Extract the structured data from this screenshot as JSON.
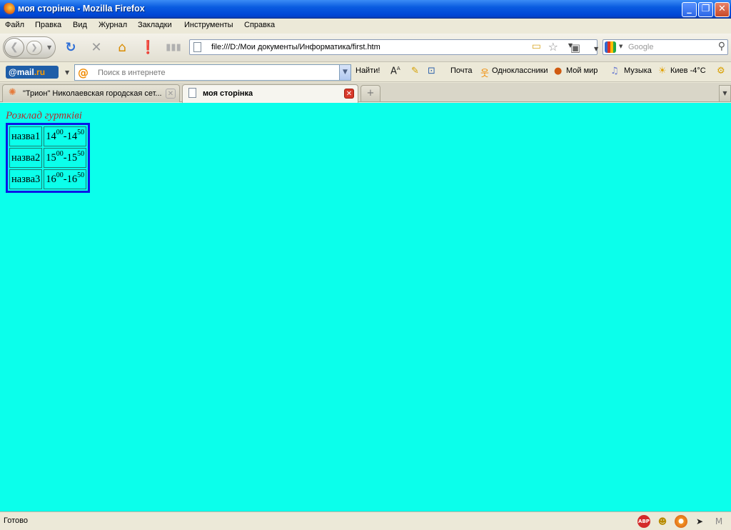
{
  "window": {
    "title": "моя сторінка - Mozilla Firefox"
  },
  "menu": [
    "Файл",
    "Правка",
    "Вид",
    "Журнал",
    "Закладки",
    "Инструменты",
    "Справка"
  ],
  "nav": {
    "url": "file:///D:/Мои документы/Информатика/first.htm",
    "search_placeholder": "Google"
  },
  "mailru": {
    "logo_text": "@mail",
    "logo_suffix": ".ru",
    "search_placeholder": "Поиск в интернете",
    "find_button": "Найти!",
    "links": {
      "mail": "Почта",
      "odnoklassniki": "Одноклассники",
      "moi_mir": "Мой мир",
      "music": "Музыка",
      "weather": "Киев -4°C"
    }
  },
  "tabs": [
    {
      "label": "\"Трион\" Николаевская городская сет...",
      "active": false
    },
    {
      "label": "моя сторінка",
      "active": true
    }
  ],
  "page": {
    "heading": "Розклад гуртківі",
    "rows": [
      {
        "name": "назва1",
        "start_h": "14",
        "start_m": "00",
        "end_h": "14",
        "end_m": "50"
      },
      {
        "name": "назва2",
        "start_h": "15",
        "start_m": "00",
        "end_h": "15",
        "end_m": "50"
      },
      {
        "name": "назва3",
        "start_h": "16",
        "start_m": "00",
        "end_h": "16",
        "end_m": "50"
      }
    ],
    "background_color": "#0bffeb",
    "table_border_color": "#0b16e7",
    "heading_color": "#b02f30"
  },
  "status": {
    "text": "Готово"
  },
  "icons": [
    "firefox-logo-icon",
    "minimize-icon",
    "restore-icon",
    "close-icon",
    "back-icon",
    "forward-icon",
    "reload-icon",
    "stop-icon",
    "home-icon",
    "addon-icon",
    "signal-icon",
    "page-icon",
    "folder-icon",
    "star-icon",
    "camera-icon",
    "google-icon",
    "magnifier-icon",
    "adblock-icon",
    "face-icon",
    "firefox-icon",
    "cursor-icon",
    "gmail-icon"
  ]
}
